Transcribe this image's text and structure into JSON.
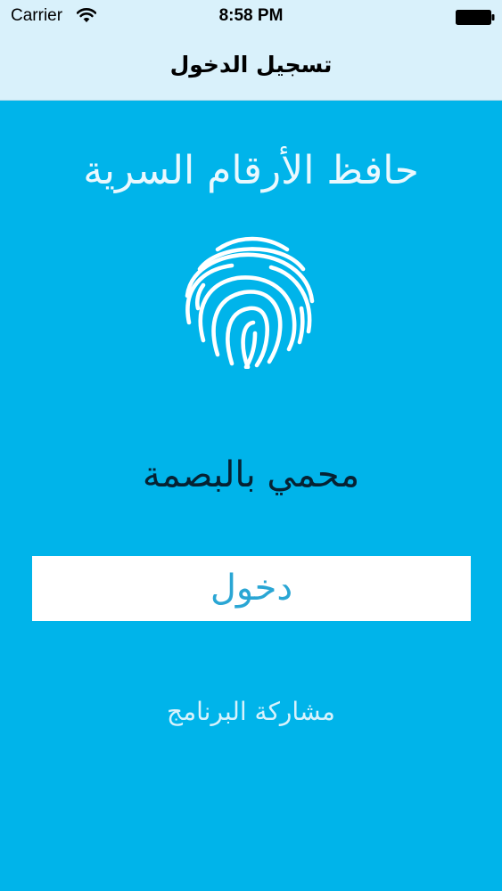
{
  "status_bar": {
    "carrier": "Carrier",
    "time": "8:58 PM",
    "wifi_icon": "wifi-icon",
    "battery_icon": "battery-full-icon"
  },
  "nav": {
    "title": "تسجيل الدخول"
  },
  "main": {
    "app_title": "حافظ الأرقام السرية",
    "fingerprint_icon": "fingerprint-icon",
    "subtitle": "محمي بالبصمة",
    "login_label": "دخول",
    "share_label": "مشاركة البرنامج"
  },
  "colors": {
    "background": "#00b4ea",
    "nav_background": "#d9f1fb",
    "button_background": "#ffffff",
    "button_text": "#2aa6d4",
    "subtitle_text": "#062233"
  }
}
